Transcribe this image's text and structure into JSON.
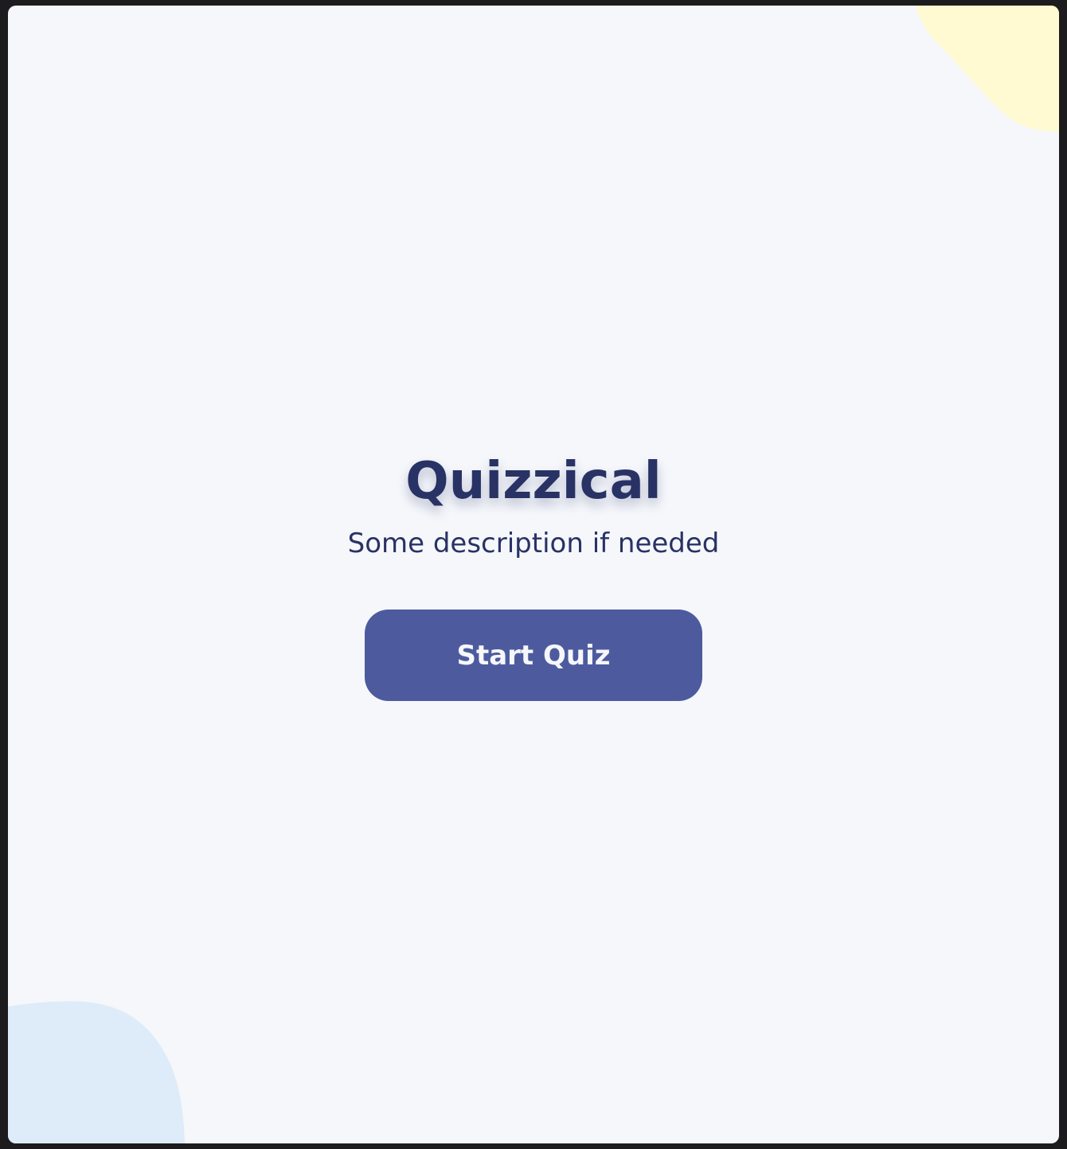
{
  "app": {
    "title": "Quizzical",
    "description": "Some description if needed"
  },
  "actions": {
    "start_label": "Start Quiz"
  },
  "colors": {
    "page_background": "#F5F7FB",
    "title_text": "#293264",
    "button_background": "#4D5B9E",
    "button_text": "#F5F7FB",
    "blob_yellow": "#FFFAD1",
    "blob_blue": "#DEEBF8"
  }
}
